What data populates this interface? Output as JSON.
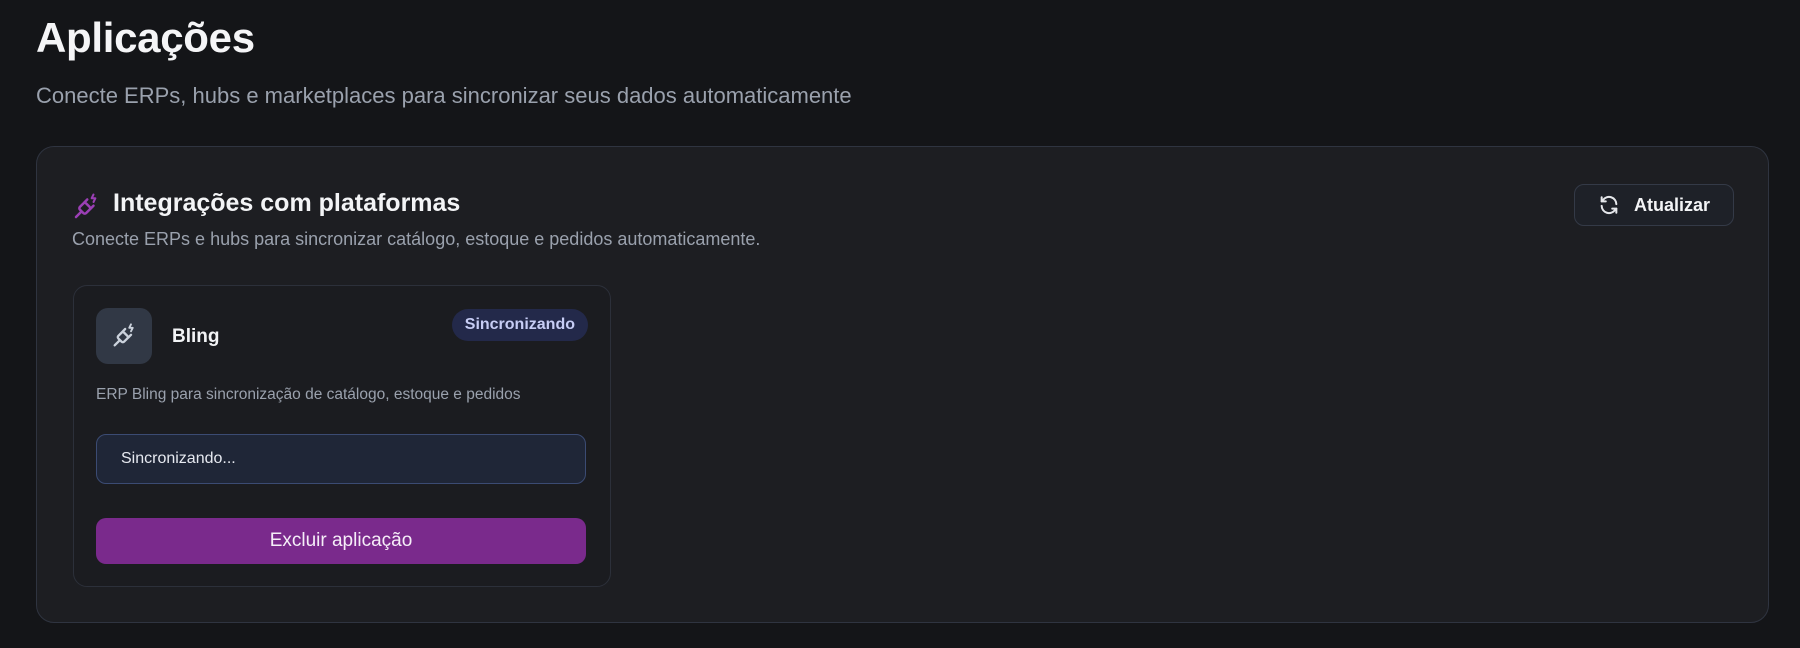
{
  "header": {
    "title": "Aplicações",
    "subtitle": "Conecte ERPs, hubs e marketplaces para sincronizar seus dados automaticamente"
  },
  "panel": {
    "icon": "plug-icon",
    "title": "Integrações com plataformas",
    "description": "Conecte ERPs e hubs para sincronizar catálogo, estoque e pedidos automaticamente.",
    "refresh_label": "Atualizar",
    "refresh_icon": "refresh-icon"
  },
  "apps": [
    {
      "logo_icon": "plug-icon",
      "name": "Bling",
      "status": "Sincronizando",
      "description": "ERP Bling para sincronização de catálogo, estoque e pedidos",
      "sync_text": "Sincronizando...",
      "delete_label": "Excluir aplicação"
    }
  ],
  "colors": {
    "background": "#141518",
    "panel": "#1d1e22",
    "accent": "#7a2a8c",
    "badge": "#23294a",
    "icon_accent": "#9b3fb5"
  }
}
